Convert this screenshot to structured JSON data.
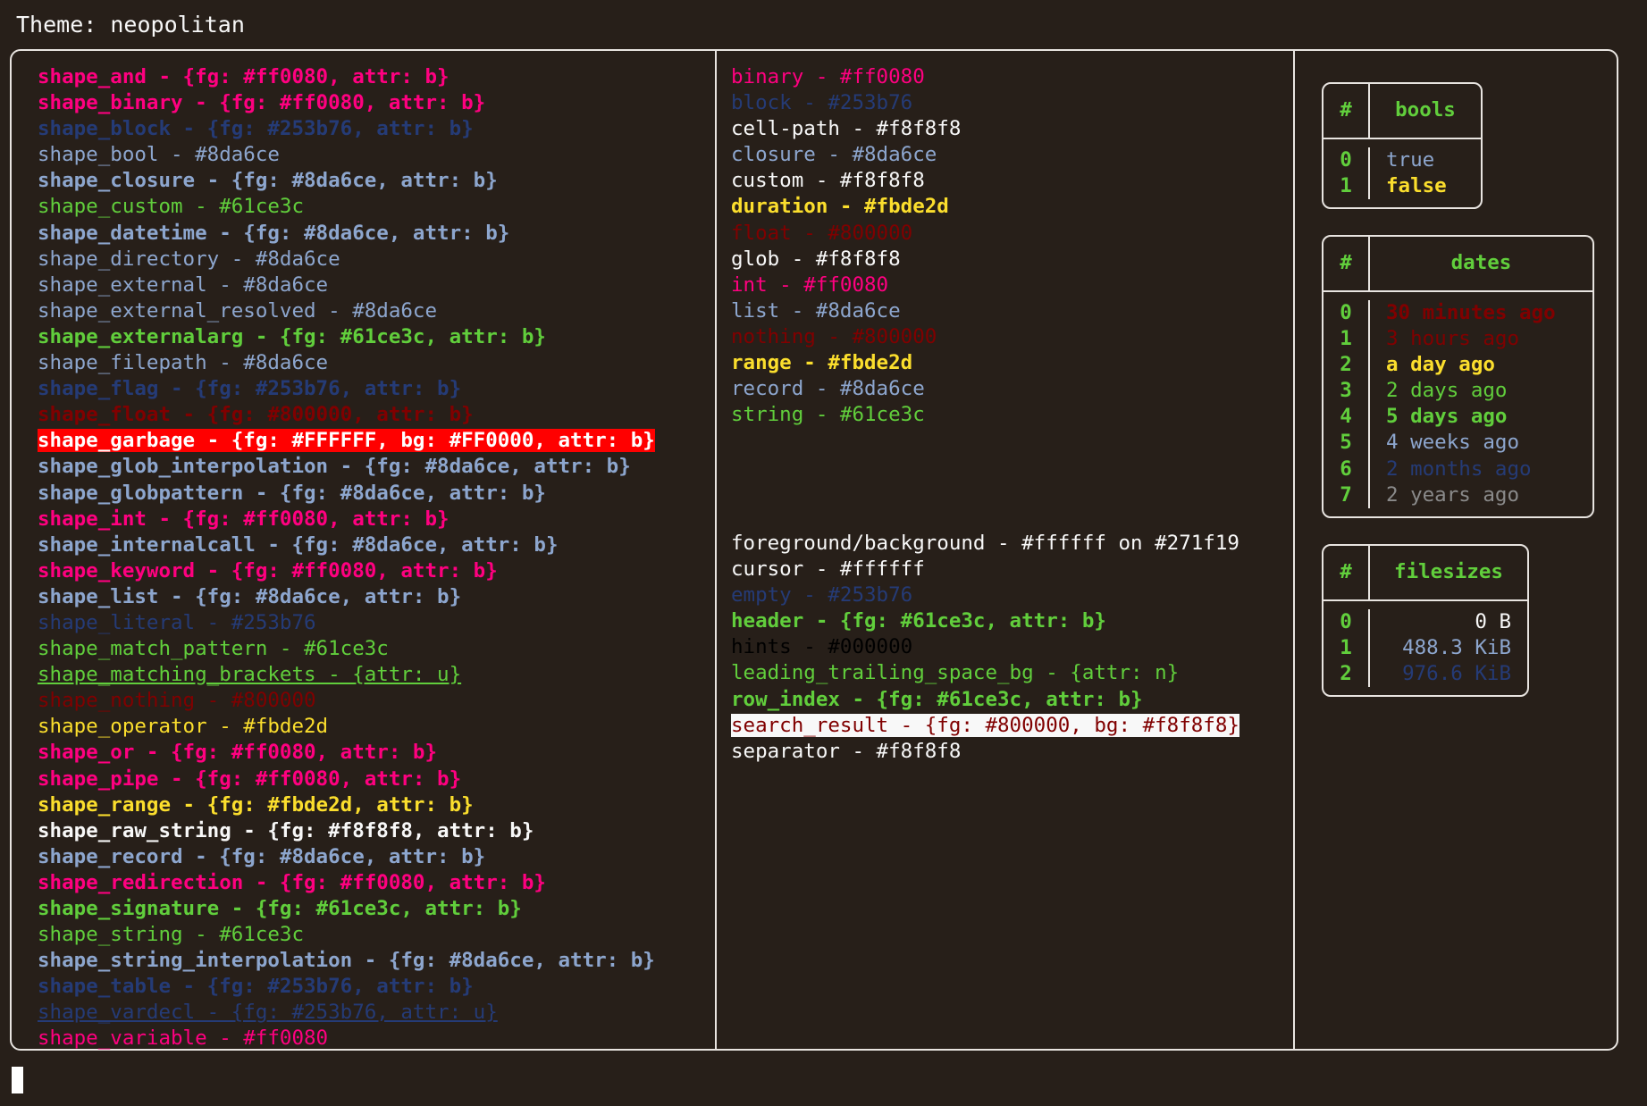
{
  "header": {
    "title": "Theme: neopolitan"
  },
  "shapes": [
    {
      "name": "shape_and",
      "value": " - {fg: #ff0080, attr: b}",
      "color": "#ff0080",
      "bold": true
    },
    {
      "name": "shape_binary",
      "value": " - {fg: #ff0080, attr: b}",
      "color": "#ff0080",
      "bold": true
    },
    {
      "name": "shape_block",
      "value": " - {fg: #253b76, attr: b}",
      "color": "#253b76",
      "bold": true
    },
    {
      "name": "shape_bool",
      "value": " - #8da6ce",
      "color": "#8da6ce",
      "bold": false
    },
    {
      "name": "shape_closure",
      "value": " - {fg: #8da6ce, attr: b}",
      "color": "#8da6ce",
      "bold": true
    },
    {
      "name": "shape_custom",
      "value": " - #61ce3c",
      "color": "#61ce3c",
      "bold": false
    },
    {
      "name": "shape_datetime",
      "value": " - {fg: #8da6ce, attr: b}",
      "color": "#8da6ce",
      "bold": true
    },
    {
      "name": "shape_directory",
      "value": " - #8da6ce",
      "color": "#8da6ce",
      "bold": false
    },
    {
      "name": "shape_external",
      "value": " - #8da6ce",
      "color": "#8da6ce",
      "bold": false
    },
    {
      "name": "shape_external_resolved",
      "value": " - #8da6ce",
      "color": "#8da6ce",
      "bold": false
    },
    {
      "name": "shape_externalarg",
      "value": " - {fg: #61ce3c, attr: b}",
      "color": "#61ce3c",
      "bold": true
    },
    {
      "name": "shape_filepath",
      "value": " - #8da6ce",
      "color": "#8da6ce",
      "bold": false
    },
    {
      "name": "shape_flag",
      "value": " - {fg: #253b76, attr: b}",
      "color": "#253b76",
      "bold": true
    },
    {
      "name": "shape_float",
      "value": " - {fg: #800000, attr: b}",
      "color": "#800000",
      "bold": true
    },
    {
      "name": "shape_garbage",
      "value": " - {fg: #FFFFFF, bg: #FF0000, attr: b}",
      "color": "#FFFFFF",
      "bg": "#FF0000",
      "bold": true
    },
    {
      "name": "shape_glob_interpolation",
      "value": " - {fg: #8da6ce, attr: b}",
      "color": "#8da6ce",
      "bold": true
    },
    {
      "name": "shape_globpattern",
      "value": " - {fg: #8da6ce, attr: b}",
      "color": "#8da6ce",
      "bold": true
    },
    {
      "name": "shape_int",
      "value": " - {fg: #ff0080, attr: b}",
      "color": "#ff0080",
      "bold": true
    },
    {
      "name": "shape_internalcall",
      "value": " - {fg: #8da6ce, attr: b}",
      "color": "#8da6ce",
      "bold": true
    },
    {
      "name": "shape_keyword",
      "value": " - {fg: #ff0080, attr: b}",
      "color": "#ff0080",
      "bold": true
    },
    {
      "name": "shape_list",
      "value": " - {fg: #8da6ce, attr: b}",
      "color": "#8da6ce",
      "bold": true
    },
    {
      "name": "shape_literal",
      "value": " - #253b76",
      "color": "#253b76",
      "bold": false
    },
    {
      "name": "shape_match_pattern",
      "value": " - #61ce3c",
      "color": "#61ce3c",
      "bold": false
    },
    {
      "name": "shape_matching_brackets",
      "value": " - {attr: u}",
      "color": "#61ce3c",
      "bold": false,
      "underline": true
    },
    {
      "name": "shape_nothing",
      "value": " - #800000",
      "color": "#800000",
      "bold": false
    },
    {
      "name": "shape_operator",
      "value": " - #fbde2d",
      "color": "#fbde2d",
      "bold": false
    },
    {
      "name": "shape_or",
      "value": " - {fg: #ff0080, attr: b}",
      "color": "#ff0080",
      "bold": true
    },
    {
      "name": "shape_pipe",
      "value": " - {fg: #ff0080, attr: b}",
      "color": "#ff0080",
      "bold": true
    },
    {
      "name": "shape_range",
      "value": " - {fg: #fbde2d, attr: b}",
      "color": "#fbde2d",
      "bold": true
    },
    {
      "name": "shape_raw_string",
      "value": " - {fg: #f8f8f8, attr: b}",
      "color": "#f8f8f8",
      "bold": true
    },
    {
      "name": "shape_record",
      "value": " - {fg: #8da6ce, attr: b}",
      "color": "#8da6ce",
      "bold": true
    },
    {
      "name": "shape_redirection",
      "value": " - {fg: #ff0080, attr: b}",
      "color": "#ff0080",
      "bold": true
    },
    {
      "name": "shape_signature",
      "value": " - {fg: #61ce3c, attr: b}",
      "color": "#61ce3c",
      "bold": true
    },
    {
      "name": "shape_string",
      "value": " - #61ce3c",
      "color": "#61ce3c",
      "bold": false
    },
    {
      "name": "shape_string_interpolation",
      "value": " - {fg: #8da6ce, attr: b}",
      "color": "#8da6ce",
      "bold": true
    },
    {
      "name": "shape_table",
      "value": " - {fg: #253b76, attr: b}",
      "color": "#253b76",
      "bold": true
    },
    {
      "name": "shape_vardecl",
      "value": " - {fg: #253b76, attr: u}",
      "color": "#253b76",
      "bold": false,
      "underline": true
    },
    {
      "name": "shape_variable",
      "value": " - #ff0080",
      "color": "#ff0080",
      "bold": false
    }
  ],
  "types": [
    {
      "name": "binary",
      "value": " - #ff0080",
      "color": "#ff0080",
      "bold": false
    },
    {
      "name": "block",
      "value": " - #253b76",
      "color": "#253b76",
      "bold": false
    },
    {
      "name": "cell-path",
      "value": " - #f8f8f8",
      "color": "#f8f8f8",
      "bold": false
    },
    {
      "name": "closure",
      "value": " - #8da6ce",
      "color": "#8da6ce",
      "bold": false
    },
    {
      "name": "custom",
      "value": " - #f8f8f8",
      "color": "#f8f8f8",
      "bold": false
    },
    {
      "name": "duration",
      "value": " - #fbde2d",
      "color": "#fbde2d",
      "bold": true
    },
    {
      "name": "float",
      "value": " - #800000",
      "color": "#800000",
      "bold": false
    },
    {
      "name": "glob",
      "value": " - #f8f8f8",
      "color": "#f8f8f8",
      "bold": false
    },
    {
      "name": "int",
      "value": " - #ff0080",
      "color": "#ff0080",
      "bold": false
    },
    {
      "name": "list",
      "value": " - #8da6ce",
      "color": "#8da6ce",
      "bold": false
    },
    {
      "name": "nothing",
      "value": " - #800000",
      "color": "#800000",
      "bold": false
    },
    {
      "name": "range",
      "value": " - #fbde2d",
      "color": "#fbde2d",
      "bold": true
    },
    {
      "name": "record",
      "value": " - #8da6ce",
      "color": "#8da6ce",
      "bold": false
    },
    {
      "name": "string",
      "value": " - #61ce3c",
      "color": "#61ce3c",
      "bold": false
    }
  ],
  "ui_elements": [
    {
      "name": "foreground/background",
      "value": " - #ffffff on #271f19",
      "color": "#f8f8f8",
      "bold": false
    },
    {
      "name": "cursor",
      "value": " - #ffffff",
      "color": "#f8f8f8",
      "bold": false
    },
    {
      "name": "empty",
      "value": " - #253b76",
      "color": "#253b76",
      "bold": false
    },
    {
      "name": "header",
      "value": " - {fg: #61ce3c, attr: b}",
      "color": "#61ce3c",
      "bold": true
    },
    {
      "name": "hints",
      "value": " - #000000",
      "color": "#000000",
      "bold": false
    },
    {
      "name": "leading_trailing_space_bg",
      "value": " - {attr: n}",
      "color": "#61ce3c",
      "bold": false
    },
    {
      "name": "row_index",
      "value": " - {fg: #61ce3c, attr: b}",
      "color": "#61ce3c",
      "bold": true
    },
    {
      "name": "search_result",
      "value": " - {fg: #800000, bg: #f8f8f8}",
      "color": "#800000",
      "bg": "#f8f8f8",
      "bold": false
    },
    {
      "name": "separator",
      "value": " - #f8f8f8",
      "color": "#f8f8f8",
      "bold": false
    }
  ],
  "tables": {
    "bools": {
      "index_header": "#",
      "name_header": "bools",
      "rows": [
        {
          "index": "0",
          "value": "true",
          "color": "#8da6ce",
          "bold": false
        },
        {
          "index": "1",
          "value": "false",
          "color": "#fbde2d",
          "bold": true
        }
      ]
    },
    "dates": {
      "index_header": "#",
      "name_header": "dates",
      "rows": [
        {
          "index": "0",
          "value": "30 minutes ago",
          "color": "#800000",
          "bold": true
        },
        {
          "index": "1",
          "value": "3 hours ago",
          "color": "#800000",
          "bold": false
        },
        {
          "index": "2",
          "value": "a day ago",
          "color": "#fbde2d",
          "bold": true
        },
        {
          "index": "3",
          "value": "2 days ago",
          "color": "#61ce3c",
          "bold": false
        },
        {
          "index": "4",
          "value": "5 days ago",
          "color": "#61ce3c",
          "bold": true
        },
        {
          "index": "5",
          "value": "4 weeks ago",
          "color": "#8da6ce",
          "bold": false
        },
        {
          "index": "6",
          "value": "2 months ago",
          "color": "#253b76",
          "bold": false
        },
        {
          "index": "7",
          "value": "2 years ago",
          "color": "#8a8a8a",
          "bold": false
        }
      ]
    },
    "filesizes": {
      "index_header": "#",
      "name_header": "filesizes",
      "rows": [
        {
          "index": "0",
          "value": "0 B",
          "color": "#f8f8f8",
          "bold": false
        },
        {
          "index": "1",
          "value": "488.3 KiB",
          "color": "#8da6ce",
          "bold": false
        },
        {
          "index": "2",
          "value": "976.6 KiB",
          "color": "#253b76",
          "bold": false
        }
      ]
    }
  },
  "palette": {
    "background": "#271f19",
    "foreground": "#f8f8f8",
    "border": "#e8e4e0",
    "pink": "#ff0080",
    "blue": "#8da6ce",
    "navy": "#253b76",
    "green": "#61ce3c",
    "yellow": "#fbde2d",
    "maroon": "#800000",
    "red_bg": "#FF0000"
  }
}
